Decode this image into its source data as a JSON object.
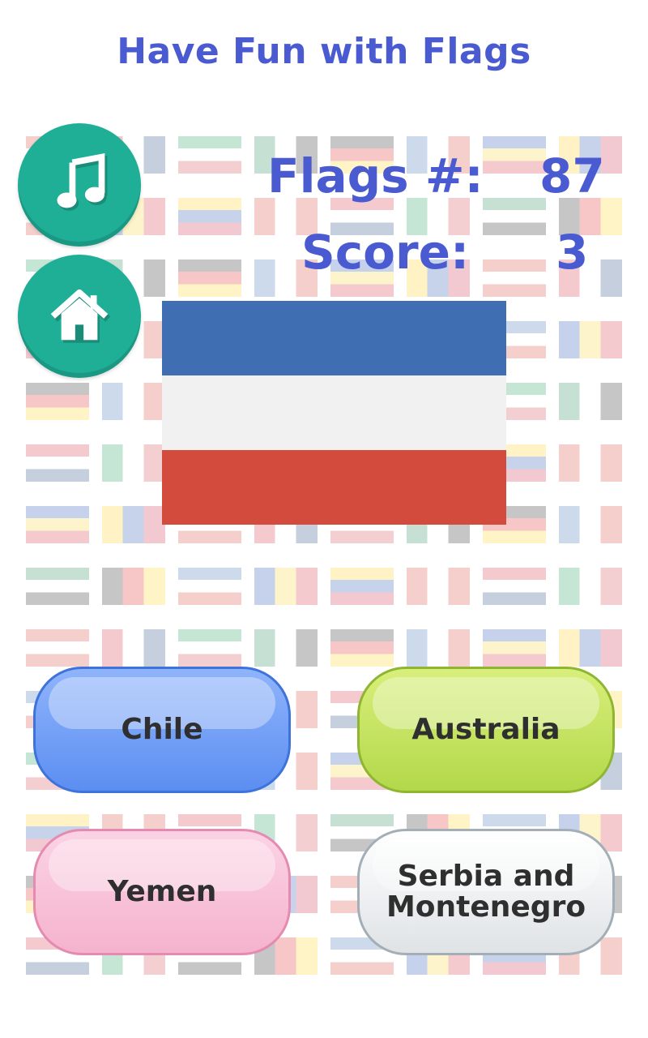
{
  "header": {
    "title": "Have Fun with Flags"
  },
  "controls": {
    "music_icon": "music-note-icon",
    "home_icon": "home-icon"
  },
  "stats": {
    "flags_label": "Flags #:",
    "flags_value": "87",
    "score_label": "Score:",
    "score_value": "3"
  },
  "question_flag": {
    "colors": [
      "#3f6fb2",
      "#f1f1f1",
      "#d24b3c"
    ]
  },
  "answers": [
    {
      "label": "Chile"
    },
    {
      "label": "Australia"
    },
    {
      "label": "Yemen"
    },
    {
      "label": "Serbia and Montenegro"
    }
  ],
  "colors": {
    "title": "#4a5bd1",
    "circle_button": "#1fae96"
  }
}
